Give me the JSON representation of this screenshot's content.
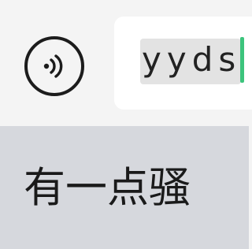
{
  "input": {
    "voice_button_icon": "voice-wave-icon",
    "composing_text": "yyds",
    "caret_color": "#3cc47c"
  },
  "candidates": [
    {
      "text": "有一点骚"
    }
  ],
  "colors": {
    "input_bar_bg": "#f4f4f4",
    "text_field_bg": "#ffffff",
    "marked_text_bg": "#e3e3e3",
    "candidate_bar_bg": "#d6d8dd"
  }
}
